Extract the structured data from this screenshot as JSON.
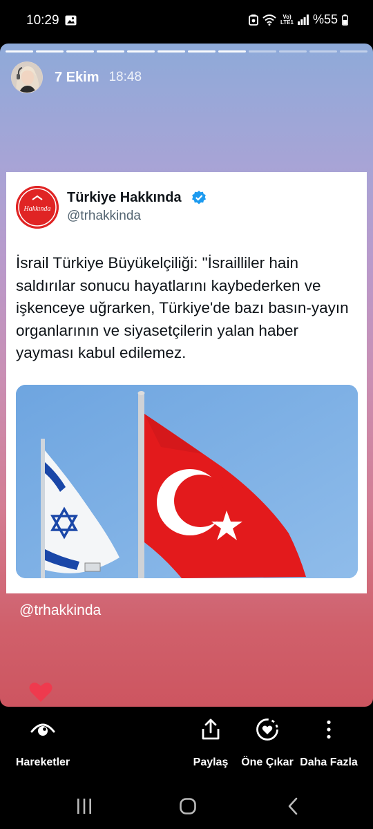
{
  "status_bar": {
    "time": "10:29",
    "volte_label": "Vo)\nLTE1",
    "battery_text": "%55",
    "icons": [
      "gallery-icon",
      "data-saver-icon",
      "wifi-icon",
      "signal-icon",
      "battery-icon"
    ]
  },
  "story": {
    "progress_segments_total": 12,
    "progress_segments_done": 8,
    "date": "7 Ekim",
    "time": "18:48",
    "mention": "@trhakkinda",
    "colors": {
      "top": "#8eaad9",
      "bottom": "#cd5560"
    }
  },
  "tweet": {
    "account_name": "Türkiye Hakkında",
    "handle": "@trhakkinda",
    "logo_text": "Hakkında",
    "text": "İsrail Türkiye Büyükelçiliği: \"İsrailliler hain saldırılar sonucu hayatlarını kaybederken ve işkenceye uğrarken, Türkiye'de bazı basın-yayın organlarının ve siyasetçilerin yalan haber yayması kabul edilemez.",
    "image_subject": "israel-flag-and-turkey-flag",
    "colors": {
      "verified": "#1d9bf0",
      "logo": "#e02424",
      "sky": "#7eaee2"
    }
  },
  "actions": [
    {
      "label": "Hareketler",
      "icon": "eye-icon"
    },
    {
      "label": "Paylaş",
      "icon": "share-icon"
    },
    {
      "label": "Öne Çıkar",
      "icon": "highlight-heart-icon"
    },
    {
      "label": "Daha Fazla",
      "icon": "more-vertical-icon"
    }
  ],
  "navigation": [
    "recent-apps-icon",
    "home-icon",
    "back-icon"
  ]
}
